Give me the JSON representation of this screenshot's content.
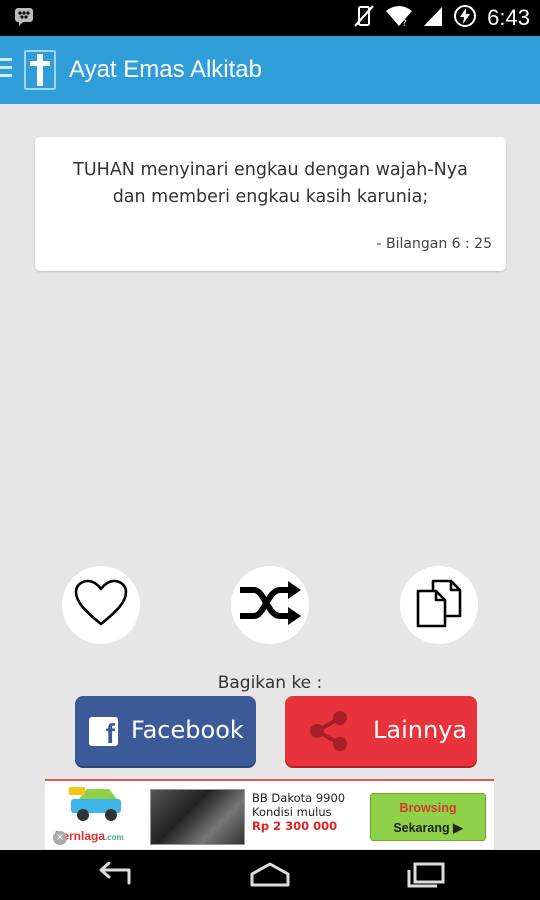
{
  "status_bar": {
    "time": "6:43",
    "icons": [
      "bbm-notification-icon",
      "mute-vibrate-icon",
      "wifi-icon",
      "signal-icon",
      "battery-charging-icon"
    ]
  },
  "app_bar": {
    "title": "Ayat Emas Alkitab",
    "logo_icon": "cross-icon",
    "menu_icon": "drawer-indicator-icon"
  },
  "verse": {
    "line1": "TUHAN menyinari engkau dengan wajah-Nya",
    "line2": "dan memberi engkau kasih karunia;",
    "reference": "- Bilangan 6 : 25"
  },
  "actions": [
    {
      "id": "favorite",
      "icon": "heart-icon"
    },
    {
      "id": "random",
      "icon": "shuffle-icon"
    },
    {
      "id": "copy",
      "icon": "copy-icon"
    }
  ],
  "share": {
    "label": "Bagikan ke :",
    "facebook_label": "Facebook",
    "other_label": "Lainnya"
  },
  "ad": {
    "brand": "bernlaga",
    "brand_suffix": ".com",
    "line1": "BB Dakota 9900",
    "line2": "Kondisi mulus",
    "price": "Rp 2 300 000",
    "cta_line1": "Browsing",
    "cta_line2": "Sekarang ▶",
    "close": "×"
  },
  "colors": {
    "action_bar": "#2f9ed8",
    "background": "#e6e6e6",
    "facebook": "#3d5a98",
    "other": "#e8323c"
  }
}
